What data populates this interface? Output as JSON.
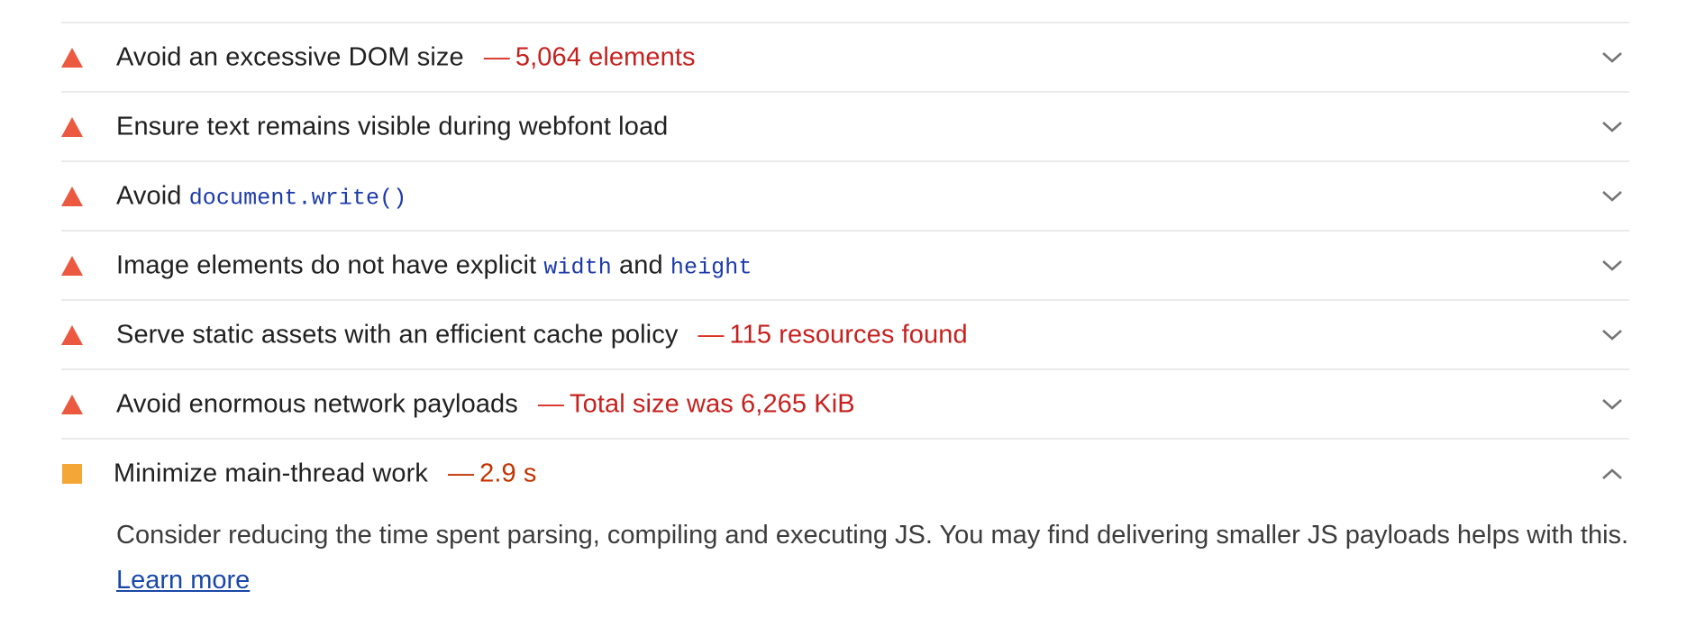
{
  "colors": {
    "fail": "#eb5940",
    "average": "#f4a637",
    "fail_text": "#c5221f",
    "average_text": "#c33300",
    "code": "#1c3aa9",
    "link": "#1a48a8",
    "divider": "#ebebeb"
  },
  "audits": [
    {
      "status": "fail",
      "icon": "warning-triangle-icon",
      "title": "Avoid an excessive DOM size",
      "separator": "—",
      "display_value": "5,064 elements",
      "expanded": false
    },
    {
      "status": "fail",
      "icon": "warning-triangle-icon",
      "title": "Ensure text remains visible during webfont load",
      "expanded": false
    },
    {
      "status": "fail",
      "icon": "warning-triangle-icon",
      "title_prefix": "Avoid",
      "title_code": "document.write()",
      "expanded": false
    },
    {
      "status": "fail",
      "icon": "warning-triangle-icon",
      "title_prefix": "Image elements do not have explicit",
      "code_1": "width",
      "title_middle": "and",
      "code_2": "height",
      "expanded": false
    },
    {
      "status": "fail",
      "icon": "warning-triangle-icon",
      "title": "Serve static assets with an efficient cache policy",
      "separator": "—",
      "display_value": "115 resources found",
      "expanded": false
    },
    {
      "status": "fail",
      "icon": "warning-triangle-icon",
      "title": "Avoid enormous network payloads",
      "separator": "—",
      "display_value": "Total size was 6,265 KiB",
      "expanded": false
    },
    {
      "status": "average",
      "icon": "warning-square-icon",
      "title": "Minimize main-thread work",
      "separator": "—",
      "display_value": "2.9 s",
      "expanded": true,
      "description": "Consider reducing the time spent parsing, compiling and executing JS. You may find delivering smaller JS payloads helps with this.",
      "learn_more": "Learn more"
    }
  ]
}
